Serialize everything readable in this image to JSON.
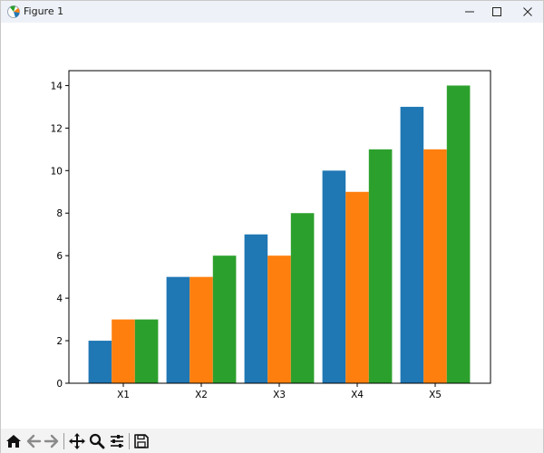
{
  "window": {
    "title": "Figure 1",
    "colors": {
      "titlebar_bg": "#eef2f8",
      "toolbar_bg": "#f3f3f3"
    }
  },
  "toolbar": {
    "icons": [
      "home-icon",
      "back-arrow-icon",
      "forward-arrow-icon",
      "pan-icon",
      "zoom-icon",
      "configure-subplots-icon",
      "save-icon"
    ]
  },
  "chart_data": {
    "type": "bar",
    "title": "",
    "xlabel": "",
    "ylabel": "",
    "categories": [
      "X1",
      "X2",
      "X3",
      "X4",
      "X5"
    ],
    "series": [
      {
        "values": [
          2,
          5,
          7,
          10,
          13
        ],
        "color": "#1f77b4"
      },
      {
        "values": [
          3,
          5,
          6,
          9,
          11
        ],
        "color": "#ff7f0e"
      },
      {
        "values": [
          3,
          6,
          8,
          11,
          14
        ],
        "color": "#2ca02c"
      }
    ],
    "yticks": [
      0,
      2,
      4,
      6,
      8,
      10,
      12,
      14
    ],
    "ylim": [
      0,
      14.7
    ],
    "grid": false,
    "legend": false
  }
}
